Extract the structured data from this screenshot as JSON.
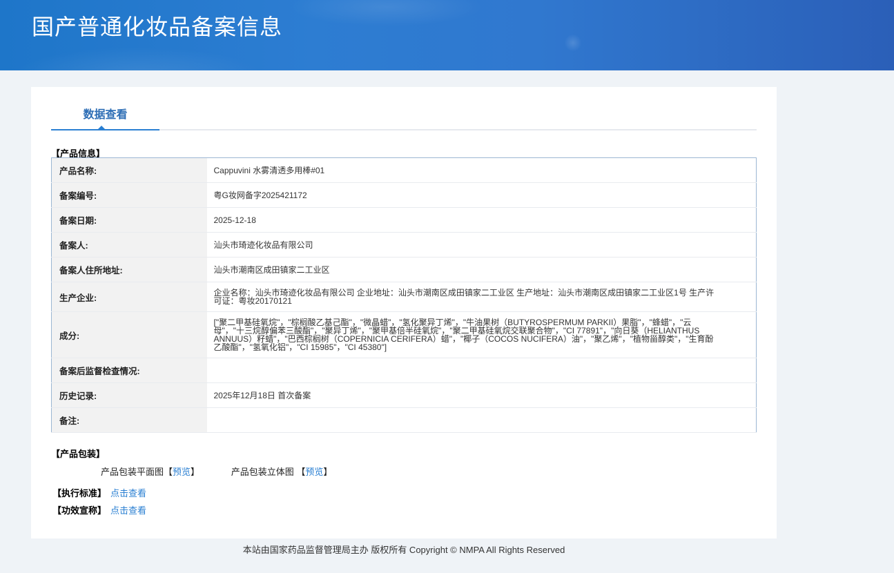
{
  "header": {
    "title": "国产普通化妆品备案信息"
  },
  "tabs": [
    {
      "label": "数据查看",
      "active": true
    }
  ],
  "product_info": {
    "section_title": "【产品信息】",
    "rows": [
      {
        "label": "产品名称:",
        "value": "Cappuvini 水雾清透多用棒#01"
      },
      {
        "label": "备案编号:",
        "value": "粤G妆网备字2025421172"
      },
      {
        "label": "备案日期:",
        "value": "2025-12-18"
      },
      {
        "label": "备案人:",
        "value": "汕头市琦迹化妆品有限公司"
      },
      {
        "label": "备案人住所地址:",
        "value": "汕头市潮南区成田镇家二工业区"
      },
      {
        "label": "生产企业:",
        "value": "企业名称：汕头市琦迹化妆品有限公司 企业地址：汕头市潮南区成田镇家二工业区 生产地址：汕头市潮南区成田镇家二工业区1号 生产许可证：粤妆20170121"
      },
      {
        "label": "成分:",
        "value": "[\"聚二甲基硅氧烷\"，\"棕榈酸乙基己酯\"，\"微晶蜡\"，\"氢化聚异丁烯\"，\"牛油果树（BUTYROSPERMUM PARKII）果脂\"，\"蜂蜡\"，\"云母\"，\"十三烷醇偏苯三酸酯\"，\"聚异丁烯\"，\"聚甲基倍半硅氧烷\"，\"聚二甲基硅氧烷交联聚合物\"，\"CI 77891\"，\"向日葵（HELIANTHUS ANNUUS）籽蜡\"，\"巴西棕榈树（COPERNICIA CERIFERA）蜡\"，\"椰子（COCOS NUCIFERA）油\"，\"聚乙烯\"，\"植物甾醇类\"，\"生育酚乙酸酯\"，\"氢氧化铝\"，\"CI 15985\"，\"CI 45380\"]"
      },
      {
        "label": "备案后监督检查情况:",
        "value": ""
      },
      {
        "label": "历史记录:",
        "value": "2025年12月18日 首次备案"
      },
      {
        "label": "备注:",
        "value": ""
      }
    ]
  },
  "packaging": {
    "section_title": "【产品包装】",
    "flat_label": "产品包装平面图",
    "solid_label": "产品包装立体图",
    "preview_label": "预览",
    "bracket_open": "【",
    "bracket_close": "】"
  },
  "standard": {
    "section_title": "【执行标准】",
    "link": "点击查看"
  },
  "efficacy": {
    "section_title": "【功效宣称】",
    "link": "点击查看"
  },
  "footer": {
    "text": "本站由国家药品监督管理局主办 版权所有 Copyright © NMPA All Rights Reserved"
  },
  "colors": {
    "header_blue": "#2d7dd2",
    "link_blue": "#2a7fd2",
    "tab_text": "#2c6db5",
    "table_border": "#9bb6d3"
  }
}
